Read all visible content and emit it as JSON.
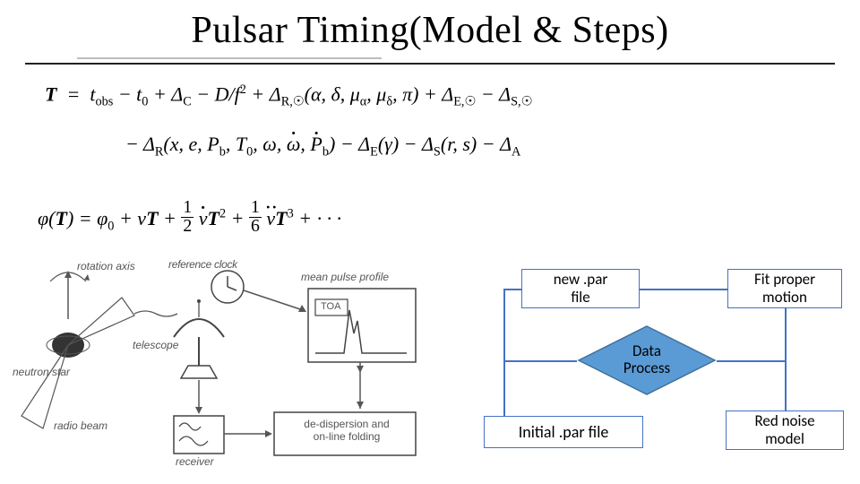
{
  "title": "Pulsar Timing(Model & Steps)",
  "equation1_html": "<b><i>T</i></b>&nbsp;&nbsp;=&nbsp;&nbsp;<i>t</i><sub>obs</sub> − <i>t</i><sub>0</sub> + Δ<sub>C</sub> − <i>D</i>/<i>f</i><sup>2</sup> + Δ<sub>R,☉</sub>(α, δ, μ<sub>α</sub>, μ<sub>δ</sub>, π) + Δ<sub>E,☉</sub> − Δ<sub>S,☉</sub>",
  "equation2_html": "− Δ<sub>R</sub>(<i>x</i>, <i>e</i>, <i>P</i><sub>b</sub>, <i>T</i><sub>0</sub>, ω, <span class='dot-over'>ω</span>, <span class='dot-over'><i>P</i></span><sub>b</sub>) − Δ<sub>E</sub>(γ) − Δ<sub>S</sub>(<i>r</i>, <i>s</i>) − Δ<sub>A</sub>",
  "equation3_html": "φ(<b><i>T</i></b>) = φ<sub>0</sub> + ν<b><i>T</i></b> + <span class='frac'><span class='n'>1</span><span class='d'>2</span></span> <span class='dot-over'>ν</span><b><i>T</i></b><sup>2</sup> + <span class='frac'><span class='n'>1</span><span class='d'>6</span></span> <span class='ddot-over'>ν</span><b><i>T</i></b><sup>3</sup> + · · ·",
  "sketch": {
    "rotation_axis": "rotation axis",
    "reference_clock": "reference clock",
    "telescope": "telescope",
    "neutron_star": "neutron star",
    "radio_beam": "radio beam",
    "receiver": "receiver",
    "mean_pulse_profile": "mean pulse profile",
    "toa": "TOA",
    "dedisp": "de-dispersion and\non-line folding"
  },
  "flow": {
    "new_par": "new .par\nfile",
    "fit_proper": "Fit proper\nmotion",
    "data_process": "Data\nProcess",
    "initial_par": "Initial .par file",
    "red_noise": "Red noise\nmodel"
  }
}
